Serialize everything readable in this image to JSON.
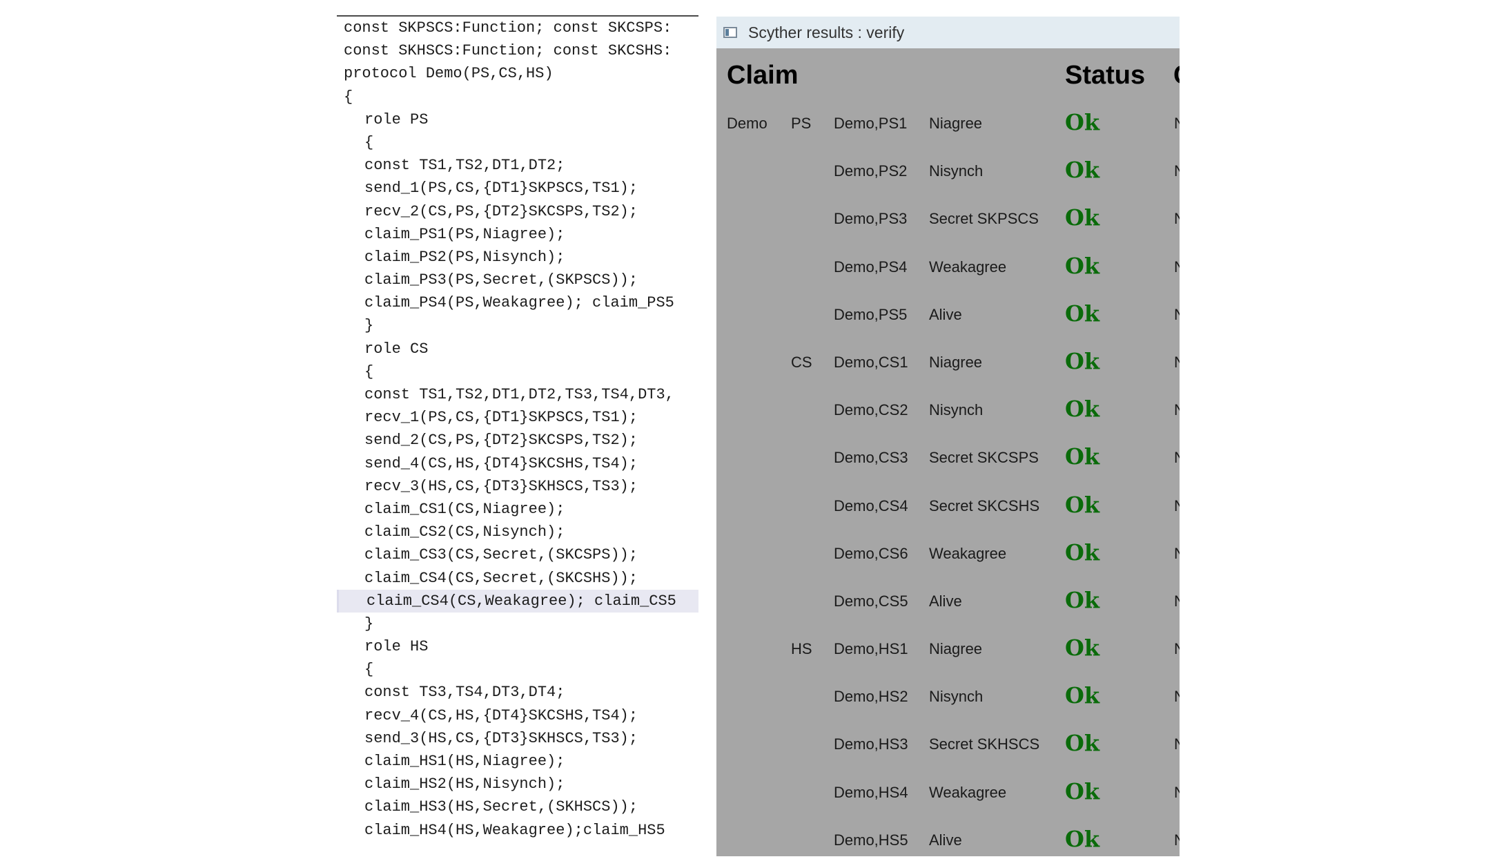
{
  "code": {
    "lines": [
      {
        "text": "const SKPSCS:Function; const SKCSPS:",
        "indent": false
      },
      {
        "text": "const SKHSCS:Function; const SKCSHS:",
        "indent": false
      },
      {
        "text": "protocol Demo(PS,CS,HS)",
        "indent": false
      },
      {
        "text": "{",
        "indent": false
      },
      {
        "text": "role PS",
        "indent": true
      },
      {
        "text": "{",
        "indent": true
      },
      {
        "text": "const TS1,TS2,DT1,DT2;",
        "indent": true
      },
      {
        "text": "send_1(PS,CS,{DT1}SKPSCS,TS1);",
        "indent": true
      },
      {
        "text": "recv_2(CS,PS,{DT2}SKCSPS,TS2);",
        "indent": true
      },
      {
        "text": "claim_PS1(PS,Niagree);",
        "indent": true
      },
      {
        "text": "claim_PS2(PS,Nisynch);",
        "indent": true
      },
      {
        "text": "claim_PS3(PS,Secret,(SKPSCS));",
        "indent": true
      },
      {
        "text": "claim_PS4(PS,Weakagree); claim_PS5",
        "indent": true
      },
      {
        "text": "}",
        "indent": true
      },
      {
        "text": "role CS",
        "indent": true
      },
      {
        "text": "{",
        "indent": true
      },
      {
        "text": "const TS1,TS2,DT1,DT2,TS3,TS4,DT3,",
        "indent": true
      },
      {
        "text": "recv_1(PS,CS,{DT1}SKPSCS,TS1);",
        "indent": true
      },
      {
        "text": "send_2(CS,PS,{DT2}SKCSPS,TS2);",
        "indent": true
      },
      {
        "text": "send_4(CS,HS,{DT4}SKCSHS,TS4);",
        "indent": true
      },
      {
        "text": "recv_3(HS,CS,{DT3}SKHSCS,TS3);",
        "indent": true
      },
      {
        "text": "claim_CS1(CS,Niagree);",
        "indent": true
      },
      {
        "text": "claim_CS2(CS,Nisynch);",
        "indent": true
      },
      {
        "text": "claim_CS3(CS,Secret,(SKCSPS));",
        "indent": true
      },
      {
        "text": "claim_CS4(CS,Secret,(SKCSHS));",
        "indent": true
      },
      {
        "text": "claim_CS4(CS,Weakagree); claim_CS5",
        "indent": true,
        "highlight": true
      },
      {
        "text": "}",
        "indent": true
      },
      {
        "text": "role HS",
        "indent": true
      },
      {
        "text": "{",
        "indent": true
      },
      {
        "text": "const TS3,TS4,DT3,DT4;",
        "indent": true
      },
      {
        "text": "recv_4(CS,HS,{DT4}SKCSHS,TS4);",
        "indent": true
      },
      {
        "text": "send_3(HS,CS,{DT3}SKHSCS,TS3);",
        "indent": true
      },
      {
        "text": "claim_HS1(HS,Niagree);",
        "indent": true
      },
      {
        "text": "claim_HS2(HS,Nisynch);",
        "indent": true
      },
      {
        "text": "claim_HS3(HS,Secret,(SKHSCS));",
        "indent": true
      },
      {
        "text": "claim_HS4(HS,Weakagree);claim_HS5",
        "indent": true
      }
    ]
  },
  "results": {
    "window_title": "Scyther results : verify",
    "headers": {
      "claim": "Claim",
      "status": "Status",
      "cut": "C"
    },
    "rows": [
      {
        "protocol": "Demo",
        "role": "PS",
        "id": "Demo,PS1",
        "claim": "Niagree",
        "status": "Ok",
        "cut": "N"
      },
      {
        "protocol": "",
        "role": "",
        "id": "Demo,PS2",
        "claim": "Nisynch",
        "status": "Ok",
        "cut": "N"
      },
      {
        "protocol": "",
        "role": "",
        "id": "Demo,PS3",
        "claim": "Secret SKPSCS",
        "status": "Ok",
        "cut": "N"
      },
      {
        "protocol": "",
        "role": "",
        "id": "Demo,PS4",
        "claim": "Weakagree",
        "status": "Ok",
        "cut": "N"
      },
      {
        "protocol": "",
        "role": "",
        "id": "Demo,PS5",
        "claim": "Alive",
        "status": "Ok",
        "cut": "N"
      },
      {
        "protocol": "",
        "role": "CS",
        "id": "Demo,CS1",
        "claim": "Niagree",
        "status": "Ok",
        "cut": "N"
      },
      {
        "protocol": "",
        "role": "",
        "id": "Demo,CS2",
        "claim": "Nisynch",
        "status": "Ok",
        "cut": "N"
      },
      {
        "protocol": "",
        "role": "",
        "id": "Demo,CS3",
        "claim": "Secret SKCSPS",
        "status": "Ok",
        "cut": "N"
      },
      {
        "protocol": "",
        "role": "",
        "id": "Demo,CS4",
        "claim": "Secret SKCSHS",
        "status": "Ok",
        "cut": "N"
      },
      {
        "protocol": "",
        "role": "",
        "id": "Demo,CS6",
        "claim": "Weakagree",
        "status": "Ok",
        "cut": "N"
      },
      {
        "protocol": "",
        "role": "",
        "id": "Demo,CS5",
        "claim": "Alive",
        "status": "Ok",
        "cut": "N"
      },
      {
        "protocol": "",
        "role": "HS",
        "id": "Demo,HS1",
        "claim": "Niagree",
        "status": "Ok",
        "cut": "N"
      },
      {
        "protocol": "",
        "role": "",
        "id": "Demo,HS2",
        "claim": "Nisynch",
        "status": "Ok",
        "cut": "N"
      },
      {
        "protocol": "",
        "role": "",
        "id": "Demo,HS3",
        "claim": "Secret SKHSCS",
        "status": "Ok",
        "cut": "N"
      },
      {
        "protocol": "",
        "role": "",
        "id": "Demo,HS4",
        "claim": "Weakagree",
        "status": "Ok",
        "cut": "N"
      },
      {
        "protocol": "",
        "role": "",
        "id": "Demo,HS5",
        "claim": "Alive",
        "status": "Ok",
        "cut": "N"
      }
    ]
  },
  "colors": {
    "status_ok": "#0a6b0a",
    "results_background": "#a6a6a6",
    "title_bar": "#e3ecf2"
  }
}
